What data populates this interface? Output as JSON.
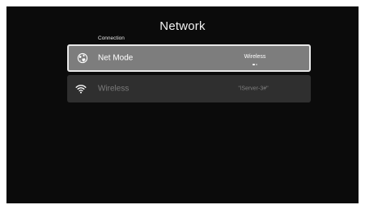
{
  "header": {
    "title": "Network"
  },
  "section": {
    "label": "Connection"
  },
  "rows": [
    {
      "label": "Net Mode",
      "value": "Wireless",
      "icon": "globe-icon",
      "selected": true,
      "page_dots": {
        "count": 2,
        "active": 0
      }
    },
    {
      "label": "Wireless",
      "value": "\"iServer-3#\"",
      "icon": "wifi-icon",
      "selected": false
    }
  ],
  "colors": {
    "background": "#0b0b0b",
    "selected_row": "#7d7d7d",
    "selected_border": "#e9e9e9",
    "row": "#2f2f2f",
    "text": "#ffffff",
    "muted_text": "#7c7c7c"
  }
}
